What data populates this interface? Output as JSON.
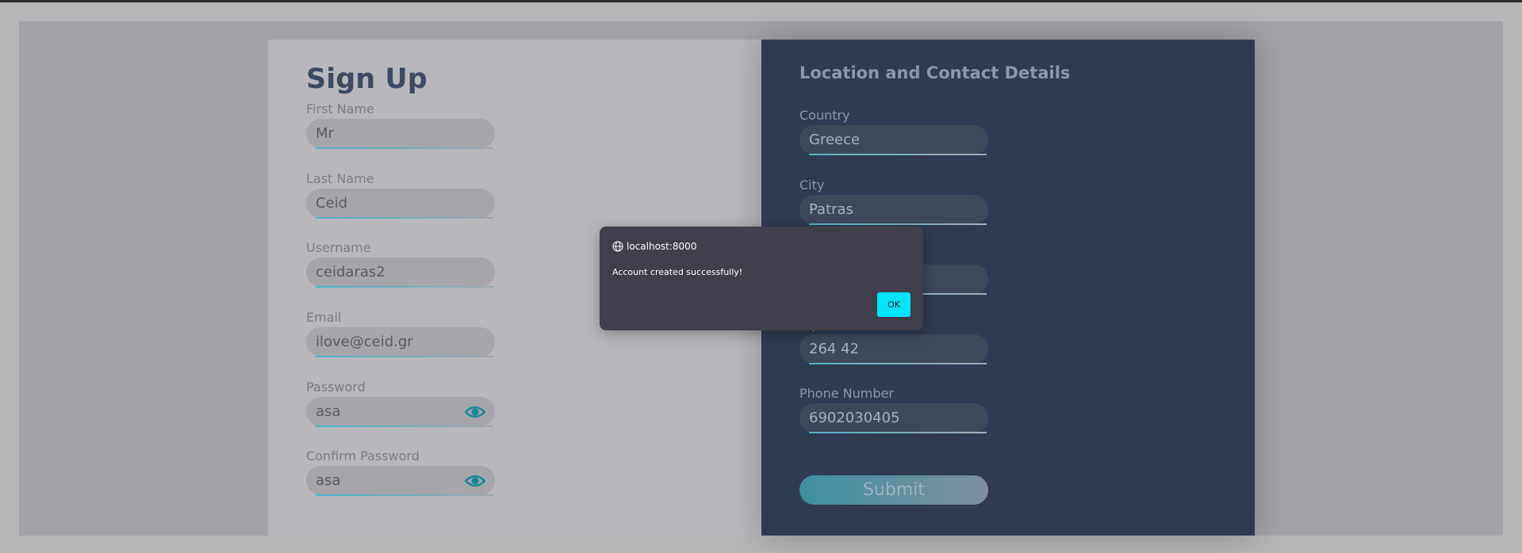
{
  "signup": {
    "title": "Sign Up",
    "fields": [
      {
        "label": "First Name",
        "value": "Mr"
      },
      {
        "label": "Last Name",
        "value": "Ceid"
      },
      {
        "label": "Username",
        "value": "ceidaras2"
      },
      {
        "label": "Email",
        "value": "ilove@ceid.gr"
      },
      {
        "label": "Password",
        "value": "asa",
        "icon": "eye-icon"
      },
      {
        "label": "Confirm Password",
        "value": "asa",
        "icon": "eye-icon"
      }
    ]
  },
  "contact": {
    "title": "Location and Contact Details",
    "fields": [
      {
        "label": "Country",
        "value": "Greece"
      },
      {
        "label": "City",
        "value": "Patras"
      },
      {
        "label": "",
        "value": ""
      },
      {
        "label": "Zip Code",
        "value": "264 42"
      },
      {
        "label": "Phone Number",
        "value": "6902030405"
      }
    ],
    "submit_label": "Submit"
  },
  "dialog": {
    "origin": "localhost:8000",
    "origin_icon": "globe-icon",
    "message": "Account created successfully!",
    "ok_label": "OK"
  },
  "colors": {
    "accent": "#00e6ff",
    "right_panel": "#2f3b52",
    "heading": "#3d4a63"
  }
}
